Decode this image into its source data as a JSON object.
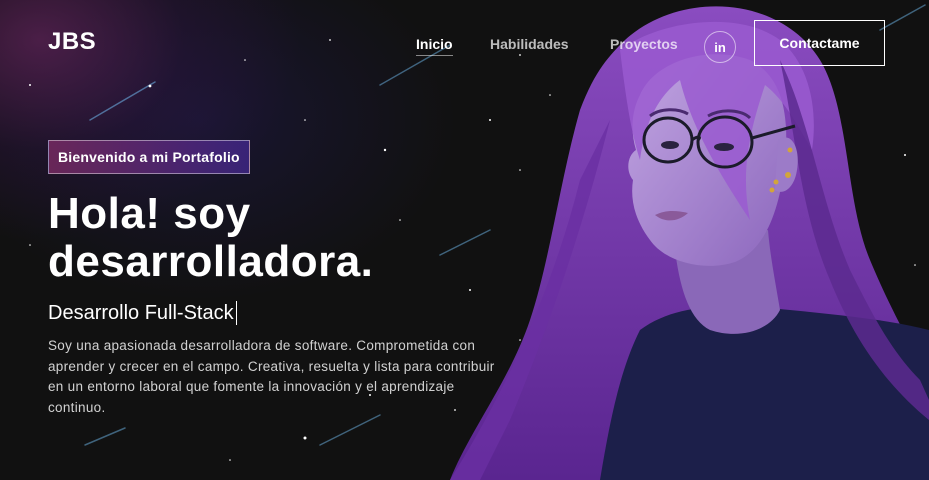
{
  "nav": {
    "logo": "JBS",
    "links": [
      {
        "label": "Inicio",
        "active": true
      },
      {
        "label": "Habilidades",
        "active": false
      },
      {
        "label": "Proyectos",
        "active": false
      }
    ],
    "social_icon": "linkedin-icon",
    "social_label": "in",
    "contact_label": "Contactame"
  },
  "hero": {
    "tagline": "Bienvenido a mi Portafolio",
    "title_line1": "Hola! soy",
    "title_line2": "desarrolladora.",
    "subtitle": "Desarrollo Full-Stack",
    "description": "Soy una apasionada desarrolladora de software. Comprometida con aprender y crecer en el campo. Creativa, resuelta y lista para contribuir en un entorno laboral que fomente la innovación y el aprendizaje continuo."
  },
  "colors": {
    "background": "#121212",
    "accent_pink": "#AA367C",
    "accent_purple": "#4A2FBD",
    "hair": "#7a3fb0",
    "shirt": "#1c1f4a",
    "skin": "#a98bd0"
  },
  "illustration": "portrait-illustration"
}
